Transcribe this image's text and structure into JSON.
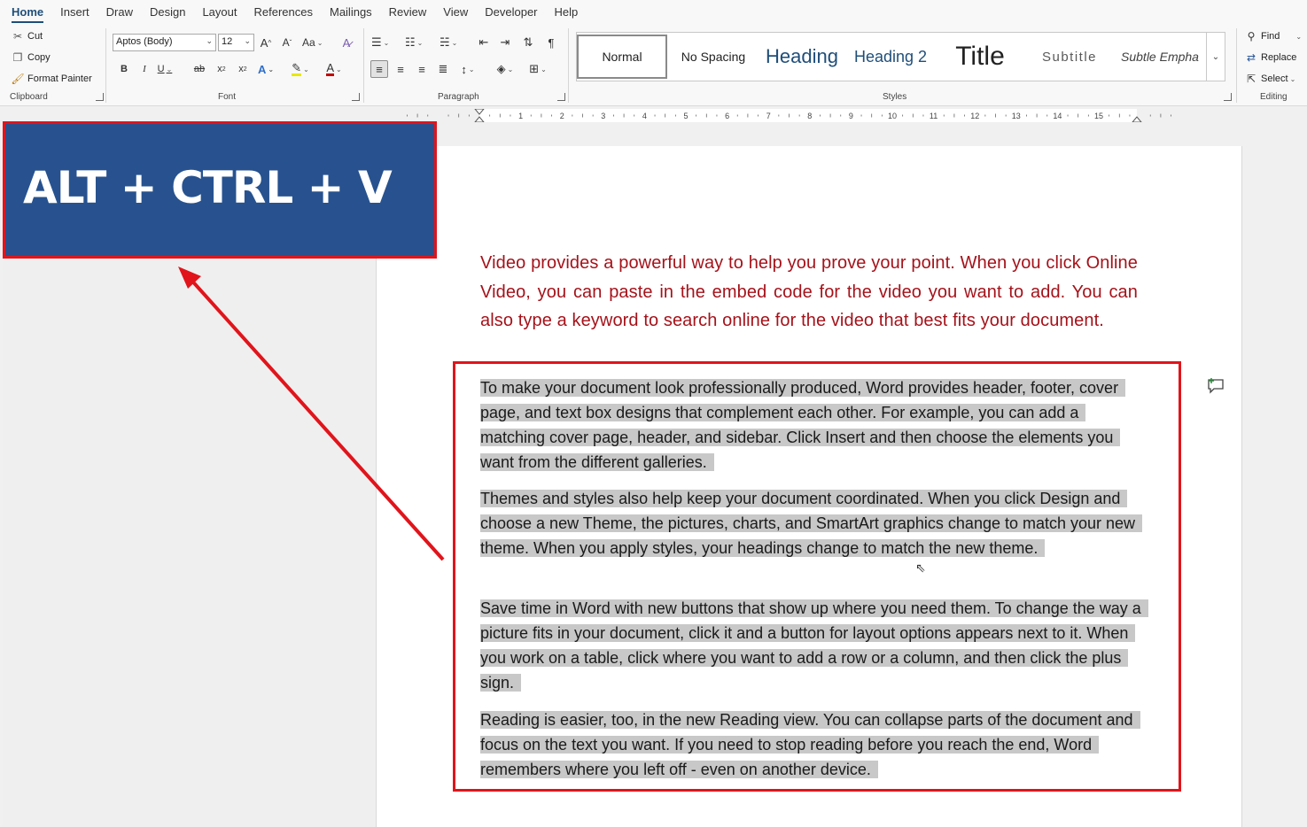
{
  "menu": {
    "tabs": [
      "Home",
      "Insert",
      "Draw",
      "Design",
      "Layout",
      "References",
      "Mailings",
      "Review",
      "View",
      "Developer",
      "Help"
    ],
    "active": "Home"
  },
  "clipboard": {
    "cut": "Cut",
    "copy": "Copy",
    "format_painter": "Format Painter",
    "label": "Clipboard"
  },
  "font": {
    "name": "Aptos (Body)",
    "size": "12",
    "label": "Font",
    "grow": "A",
    "shrink": "A",
    "case": "Aa",
    "bold": "B",
    "italic": "I",
    "underline": "U",
    "strike": "ab",
    "subscript": "x",
    "superscript": "x",
    "text_effects": "A",
    "font_color": "A"
  },
  "paragraph": {
    "label": "Paragraph",
    "pilcrow": "¶"
  },
  "styles": {
    "label": "Styles",
    "items": [
      "Normal",
      "No Spacing",
      "Heading",
      "Heading 2",
      "Title",
      "Subtitle",
      "Subtle Empha"
    ],
    "selected": "Normal"
  },
  "editing": {
    "find": "Find",
    "replace": "Replace",
    "select": "Select",
    "label": "Editing"
  },
  "ruler": {
    "marks": [
      "1",
      "2",
      "3",
      "4",
      "5",
      "6",
      "7",
      "8",
      "9",
      "10",
      "11",
      "12",
      "13",
      "14",
      "15"
    ]
  },
  "callout": {
    "text": "ALT + CTRL + V"
  },
  "document": {
    "red_paragraph": "Video provides a powerful way to help you prove your point. When you click Online Video, you can paste in the embed code for the video you want to add. You can also type a keyword to search online for the video that best fits your document.",
    "paragraphs": [
      "To make your document look professionally produced, Word provides header, footer, cover page, and text box designs that complement each other. For example, you can add a matching cover page, header, and sidebar. Click Insert and then choose the elements you want from the different galleries.",
      "Themes and styles also help keep your document coordinated. When you click Design and choose a new Theme, the pictures, charts, and SmartArt graphics change to match your new theme. When you apply styles, your headings change to match the new theme.",
      "Save time in Word with new buttons that show up where you need them. To change the way a picture fits in your document, click it and a button for layout options appears next to it. When you work on a table, click where you want to add a row or a column, and then click the plus sign.",
      "Reading is easier, too, in the new Reading view. You can collapse parts of the document and focus on the text you want. If you need to stop reading before you reach the end, Word remembers where you left off - even on another device."
    ]
  },
  "colors": {
    "callout_bg": "#27528f",
    "highlight_red": "#e1141b",
    "red_text": "#a5121a",
    "selection": "#c8c8c8"
  }
}
